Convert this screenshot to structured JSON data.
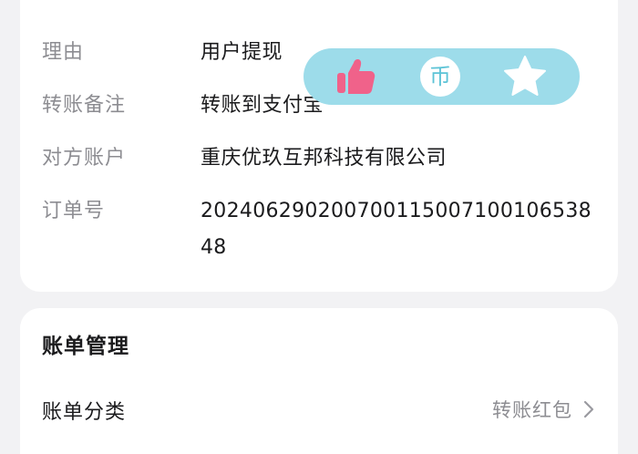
{
  "details": {
    "rows": [
      {
        "label": "理由",
        "value": "用户提现"
      },
      {
        "label": "转账备注",
        "value": "转账到支付宝"
      },
      {
        "label": "对方账户",
        "value": "重庆优玖互邦科技有限公司"
      },
      {
        "label": "订单号",
        "value": "20240629020070011500710010653848"
      }
    ]
  },
  "bill": {
    "title": "账单管理",
    "category_label": "账单分类",
    "category_value": "转账红包"
  },
  "float_bar": {
    "coin_symbol": "币",
    "colors": {
      "bar": "#9ddcea",
      "like": "#f0628a",
      "icon_white": "#ffffff"
    }
  }
}
